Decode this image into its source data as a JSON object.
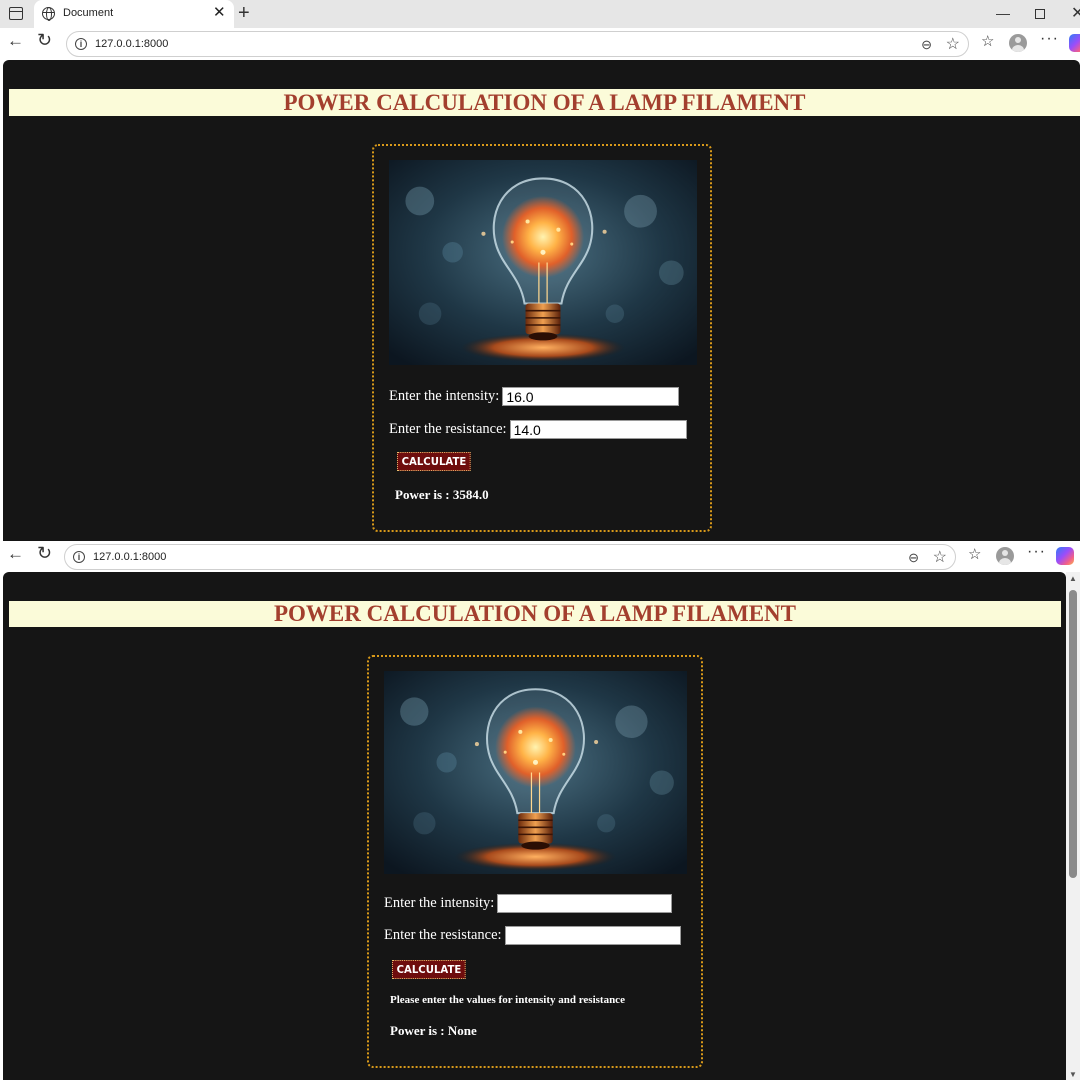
{
  "browser": {
    "tab_title": "Document",
    "tab_close": "✕",
    "new_tab": "+",
    "url": "127.0.0.1:8000",
    "icons": [
      "sidebar-icon",
      "globe-icon",
      "back-icon",
      "reload-icon",
      "info-icon",
      "zoom-icon",
      "star-icon",
      "favorites-icon",
      "profile-icon",
      "more-icon",
      "copilot-icon"
    ]
  },
  "window1": {
    "title": "POWER CALCULATION OF A LAMP FILAMENT",
    "intensity_label": "Enter the intensity:",
    "intensity_value": "16.0",
    "resistance_label": "Enter the resistance:",
    "resistance_value": "14.0",
    "button_label": "CALCULATE",
    "result": "Power is : 3584.0"
  },
  "window2": {
    "title": "POWER CALCULATION OF A LAMP FILAMENT",
    "intensity_label": "Enter the intensity:",
    "intensity_value": "",
    "resistance_label": "Enter the resistance:",
    "resistance_value": "",
    "button_label": "CALCULATE",
    "message": "Please enter the values for intensity and resistance",
    "result": "Power is : None"
  },
  "colors": {
    "page_bg": "#151515",
    "title_bg": "#fbfbd9",
    "title_text": "#a33f2e",
    "card_border": "#d99a1a",
    "button_bg": "#6e0d0d"
  }
}
